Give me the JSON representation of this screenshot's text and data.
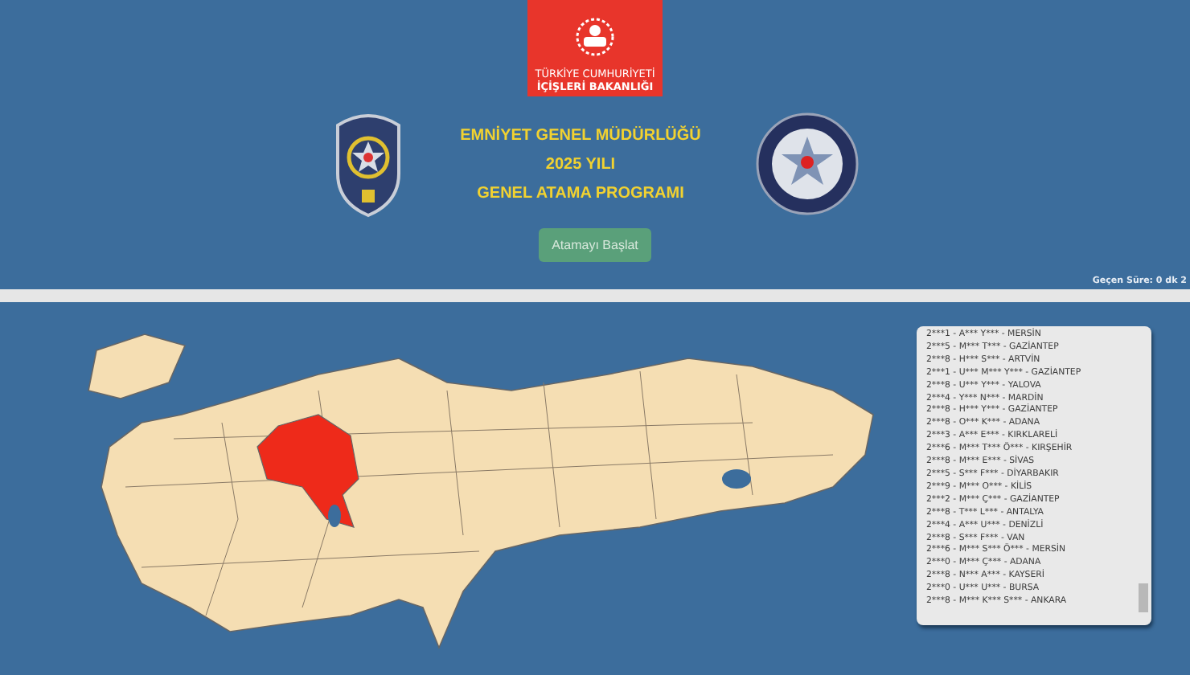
{
  "ministry_logo": {
    "line_1": "TÜRKİYE CUMHURİYETİ",
    "line_2": "İÇİŞLERİ BAKANLIĞI"
  },
  "title_lines": [
    "EMNİYET GENEL MÜDÜRLÜĞÜ",
    "2025 YILI",
    "GENEL ATAMA PROGRAMI"
  ],
  "start_button": {
    "label": "Atamayı Başlat"
  },
  "elapsed": "Geçen Süre: 0 dk 2",
  "assignments": [
    "2***1 - A*** Y*** - MERSİN",
    "2***5 - M*** T*** - GAZİANTEP",
    "2***8 - H*** S*** - ARTVİN",
    "2***1 - U*** M*** Y*** - GAZİANTEP",
    "2***8 - U*** Y*** - YALOVA",
    "2***4 - Y*** N*** - MARDİN",
    "2***8 - H*** Y*** - GAZİANTEP",
    "2***8 - O*** K*** - ADANA",
    "2***3 - A*** E*** - KIRKLARELİ",
    "2***6 - M*** T*** Ö*** - KIRŞEHİR",
    "2***8 - M*** E*** - SİVAS",
    "2***5 - S*** F*** - DİYARBAKIR",
    "2***9 - M*** O*** - KİLİS",
    "2***2 - M*** Ç*** - GAZİANTEP",
    "2***8 - T*** L*** - ANTALYA",
    "2***4 - A*** U*** - DENİZLİ",
    "2***8 - S*** F*** - VAN",
    "2***6 - M*** S*** Ö*** - MERSİN",
    "2***0 - M*** Ç*** - ADANA",
    "2***8 - N*** A*** - KAYSERİ",
    "2***0 - U*** U*** - BURSA",
    "2***8 - M*** K*** S*** - ANKARA"
  ]
}
